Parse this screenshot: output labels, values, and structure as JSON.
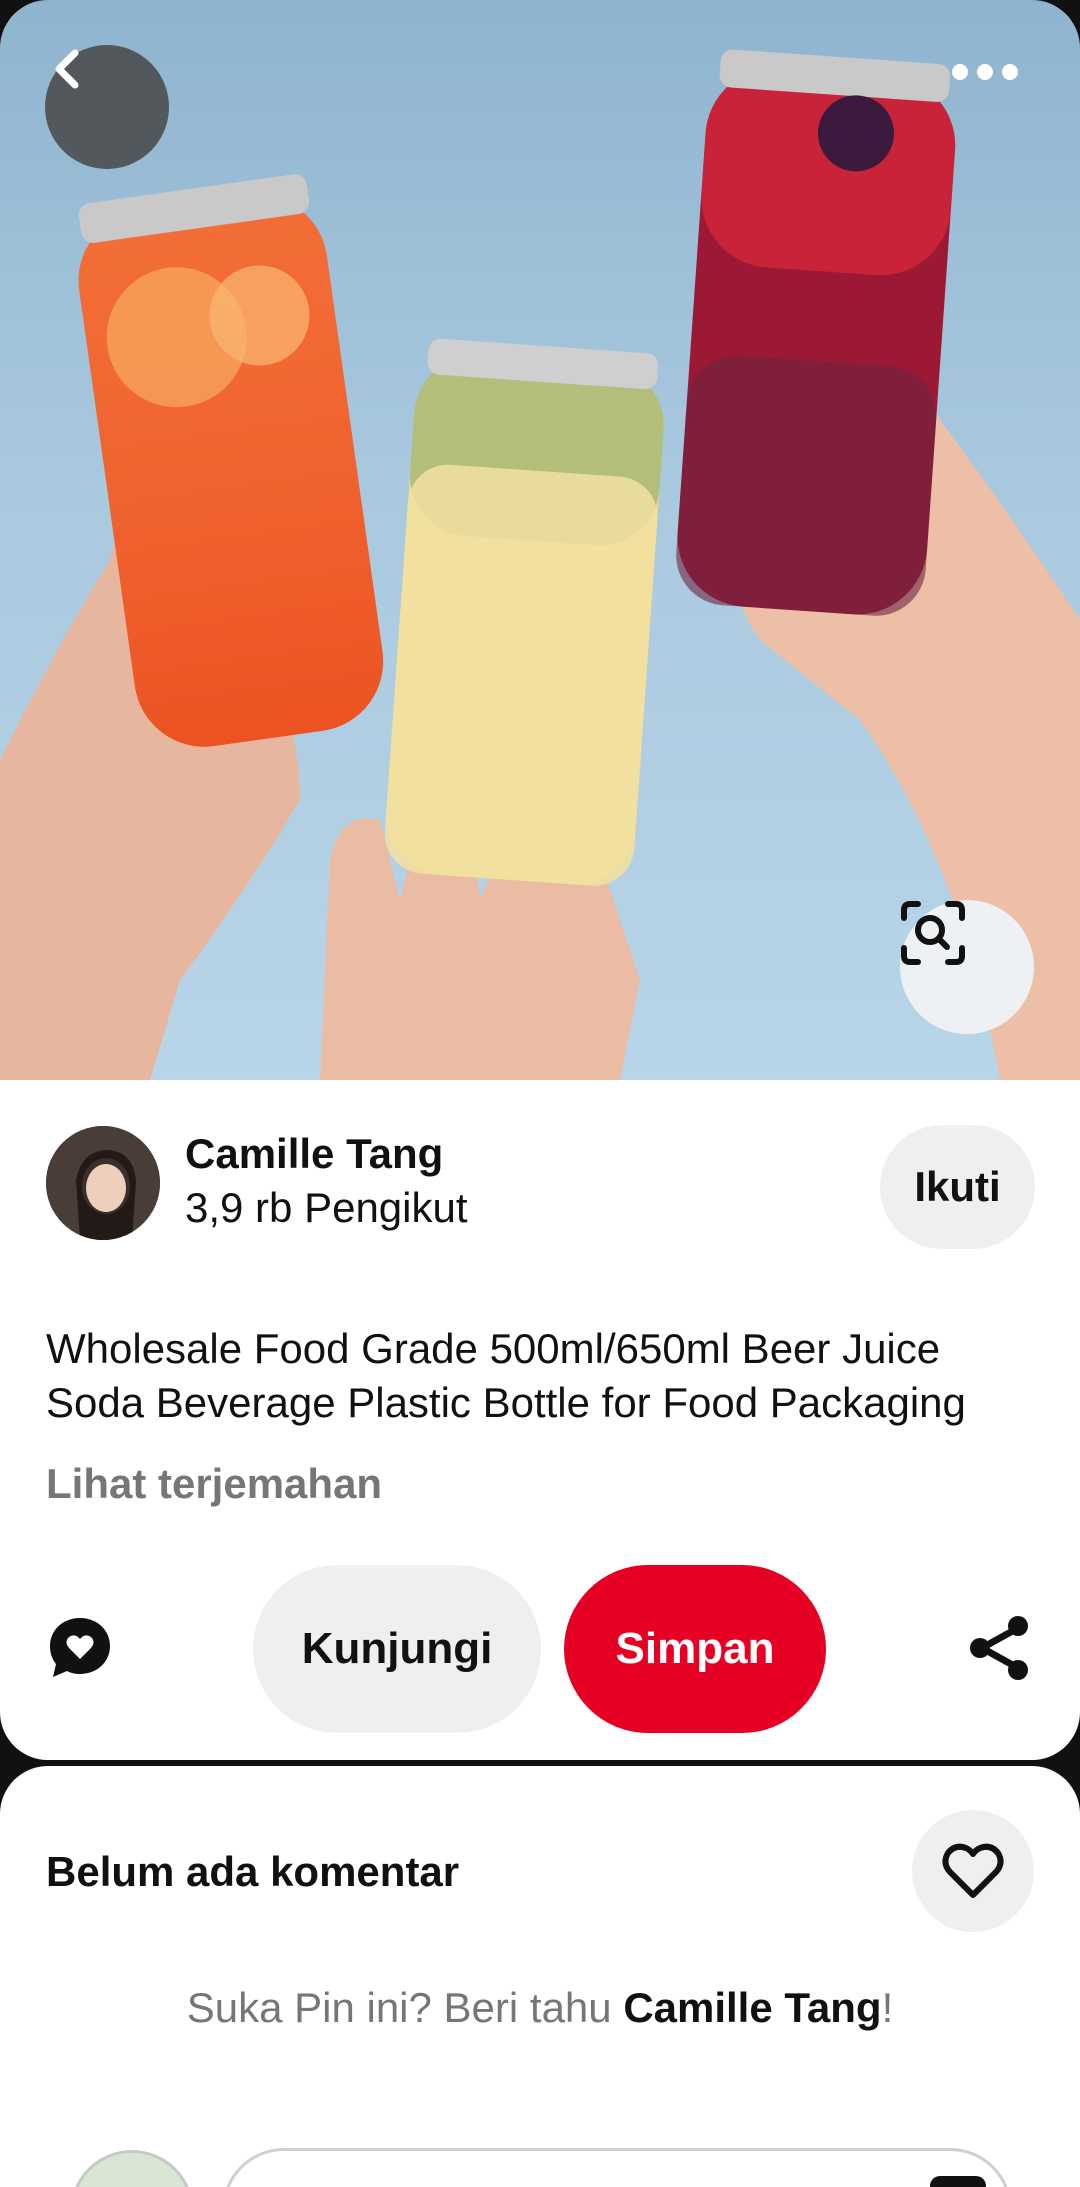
{
  "pin": {
    "creator_name": "Camille Tang",
    "followers": "3,9 rb Pengikut",
    "follow_label": "Ikuti",
    "description": "Wholesale Food Grade 500ml/650ml Beer Juice Soda Beverage Plastic Bottle for Food Packaging",
    "translate_label": "Lihat terjemahan"
  },
  "actions": {
    "visit_label": "Kunjungi",
    "save_label": "Simpan"
  },
  "comments": {
    "title": "Belum ada komentar",
    "prompt_prefix": "Suka Pin ini? Beri tahu ",
    "prompt_name": "Camille Tang",
    "prompt_suffix": "!"
  },
  "icons": {
    "back": "chevron-left-icon",
    "more": "ellipsis-icon",
    "lens": "visual-search-icon",
    "comment": "comment-heart-icon",
    "share": "share-icon",
    "heart": "heart-icon"
  },
  "colors": {
    "save": "#e60023",
    "secondary_button": "#efefef",
    "muted_text": "#767676"
  }
}
